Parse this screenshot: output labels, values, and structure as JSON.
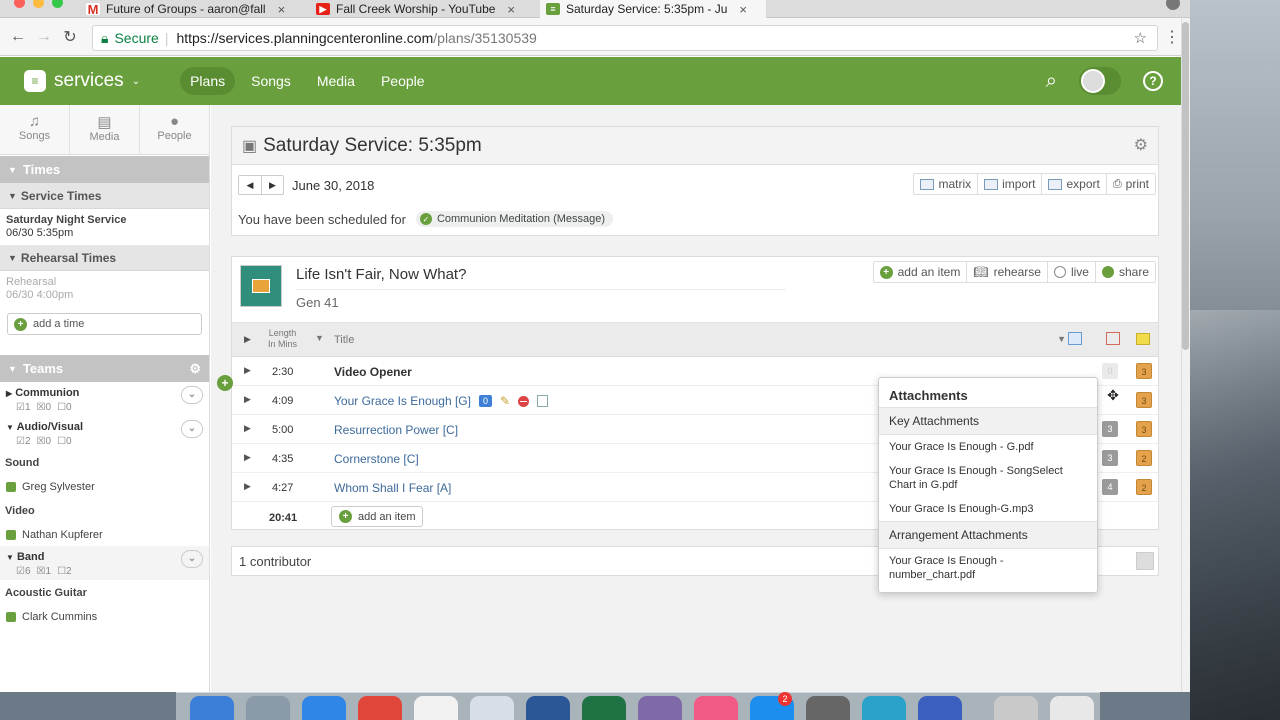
{
  "browser": {
    "tabs": [
      {
        "label": "Future of Groups - aaron@fall",
        "icon": "gmail-icon",
        "color": "#d93025"
      },
      {
        "label": "Fall Creek Worship - YouTube",
        "icon": "youtube-icon",
        "color": "#e62117"
      },
      {
        "label": "Saturday Service: 5:35pm - Ju",
        "icon": "services-icon",
        "color": "#6a9f3e"
      }
    ],
    "secure_label": "Secure",
    "url_host": "https://services.planningcenteronline.com",
    "url_path": "/plans/35130539"
  },
  "app": {
    "logo_text": "services",
    "nav": [
      "Plans",
      "Songs",
      "Media",
      "People"
    ],
    "accent": "#6a9f3e"
  },
  "sidebar": {
    "tools": [
      "Songs",
      "Media",
      "People"
    ],
    "times_header": "Times",
    "service_times_header": "Service Times",
    "service_time_name": "Saturday Night Service",
    "service_time_date": "06/30 5:35pm",
    "rehearsal_header": "Rehearsal Times",
    "rehearsal_name": "Rehearsal",
    "rehearsal_date": "06/30 4:00pm",
    "add_time": "add a time",
    "teams_header": "Teams",
    "teams": [
      {
        "name": "Communion",
        "counts": [
          "1",
          "0",
          "0"
        ]
      },
      {
        "name": "Audio/Visual",
        "counts": [
          "2",
          "0",
          "0"
        ]
      }
    ],
    "sound_role": "Sound",
    "sound_person": "Greg Sylvester",
    "video_role": "Video",
    "video_person": "Nathan Kupferer",
    "band": {
      "name": "Band",
      "counts": [
        "6",
        "1",
        "2"
      ]
    },
    "guitar_role": "Acoustic Guitar",
    "guitar_person": "Clark Cummins"
  },
  "plan": {
    "title": "Saturday Service: 5:35pm",
    "date": "June 30, 2018",
    "actions": [
      "matrix",
      "import",
      "export",
      "print"
    ],
    "scheduled_prefix": "You have been scheduled for",
    "scheduled_role": "Communion Meditation (Message)"
  },
  "order": {
    "series_title": "Life Isn't Fair, Now What?",
    "series_sub": "Gen 41",
    "actions": [
      "add an item",
      "rehearse",
      "live",
      "share"
    ],
    "col_length": "Length",
    "col_length2": "In Mins",
    "col_title": "Title",
    "items": [
      {
        "length": "2:30",
        "title": "Video Opener",
        "b1": "0",
        "b2": "3"
      },
      {
        "length": "4:09",
        "title": "Your Grace Is Enough [G]",
        "b1": "",
        "b2": "3",
        "badge": "0"
      },
      {
        "length": "5:00",
        "title": "Resurrection Power [C]",
        "b1": "3",
        "b2": "3"
      },
      {
        "length": "4:35",
        "title": "Cornerstone [C]",
        "b1": "3",
        "b2": "2"
      },
      {
        "length": "4:27",
        "title": "Whom Shall I Fear [A]",
        "b1": "4",
        "b2": "2"
      }
    ],
    "total": "20:41",
    "add_item": "add an item",
    "contributors": "1 contributor"
  },
  "attachments": {
    "title": "Attachments",
    "key_header": "Key Attachments",
    "key_items": [
      "Your Grace Is Enough - G.pdf",
      "Your Grace Is Enough - SongSelect Chart in G.pdf",
      "Your Grace Is Enough-G.mp3"
    ],
    "arr_header": "Arrangement Attachments",
    "arr_items": [
      "Your Grace Is Enough - number_chart.pdf"
    ]
  }
}
